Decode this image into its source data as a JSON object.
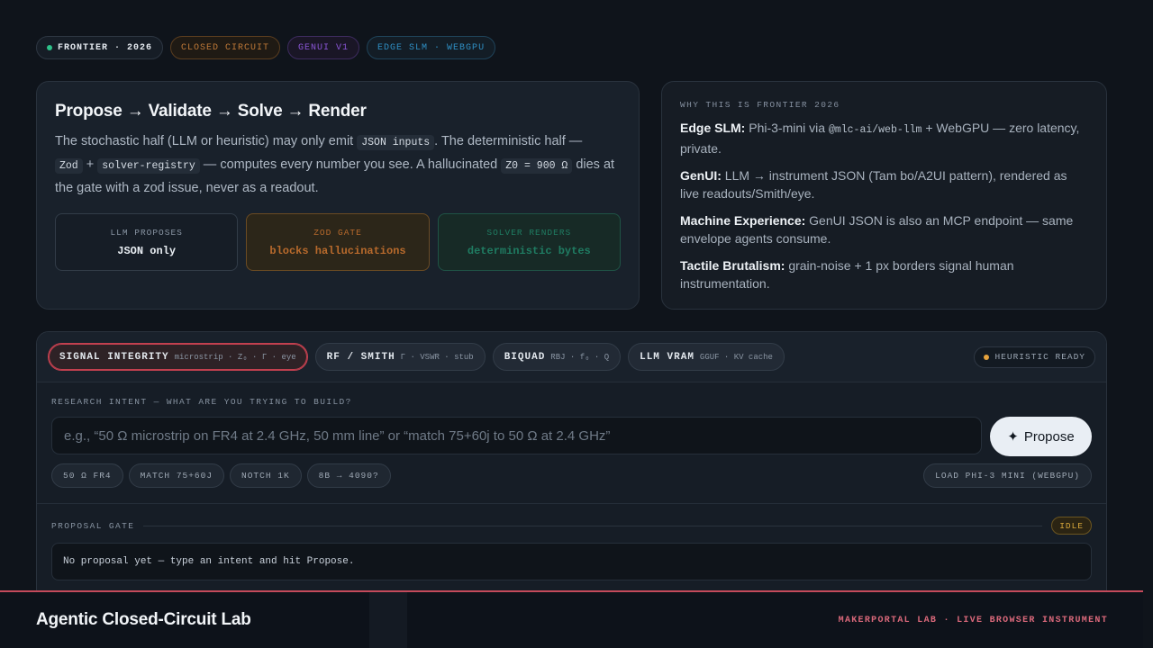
{
  "chips": {
    "frontier": "FRONTIER · 2026",
    "closed": "CLOSED CIRCUIT",
    "genui": "GENUI V1",
    "edge": "EDGE SLM · WEBGPU"
  },
  "pipeline": {
    "title": "Propose → Validate → Solve → Render",
    "desc_1": "The stochastic half (LLM or heuristic) may only emit ",
    "code_1": "JSON inputs",
    "desc_2": ". The deterministic half —",
    "code_2": "Zod",
    "desc_3": " + ",
    "code_3": "solver-registry",
    "desc_4": " — computes every number you see. A hallucinated ",
    "code_4": "Z0 = 900 Ω",
    "desc_5": " dies at the gate with a zod issue, never as a readout.",
    "stages": [
      {
        "label": "LLM PROPOSES",
        "value": "JSON only"
      },
      {
        "label": "ZOD GATE",
        "value": "blocks hallucinations"
      },
      {
        "label": "SOLVER RENDERS",
        "value": "deterministic bytes"
      }
    ]
  },
  "why": {
    "label": "WHY THIS IS FRONTIER 2026",
    "items": [
      {
        "title": "Edge SLM:",
        "text_a": " Phi-3-mini via ",
        "code": "@mlc-ai/web-llm",
        "text_b": " + WebGPU — zero latency, private."
      },
      {
        "title": "GenUI:",
        "text": " LLM → instrument JSON (Tam bo/A2UI pattern), rendered as live readouts/Smith/eye."
      },
      {
        "title": "Machine Experience:",
        "text": " GenUI JSON is also an MCP endpoint — same envelope agents consume."
      },
      {
        "title": "Tactile Brutalism:",
        "text": " grain-noise + 1 px borders signal human instrumentation."
      }
    ]
  },
  "tabs": [
    {
      "name": "SIGNAL INTEGRITY",
      "sub": "microstrip · Z₀ · Γ · eye",
      "active": true
    },
    {
      "name": "RF / SMITH",
      "sub": "Γ · VSWR · stub",
      "active": false
    },
    {
      "name": "BIQUAD",
      "sub": "RBJ · f₀ · Q",
      "active": false
    },
    {
      "name": "LLM VRAM",
      "sub": "GGUF · KV cache",
      "active": false
    }
  ],
  "status": {
    "heuristic": "HEURISTIC READY",
    "dot_color": "#e6a23c"
  },
  "intent": {
    "label": "RESEARCH INTENT — WHAT ARE YOU TRYING TO BUILD?",
    "placeholder": "e.g., “50 Ω microstrip on FR4 at 2.4 GHz, 50 mm line” or “match 75+60j to 50 Ω at 2.4 GHz”",
    "propose_label": "Propose",
    "presets": [
      "50 Ω FR4",
      "MATCH 75+60J",
      "NOTCH 1K",
      "8B → 4090?"
    ],
    "load_label": "LOAD PHI-3 MINI (WEBGPU)"
  },
  "gate": {
    "label": "PROPOSAL GATE",
    "badge": "IDLE",
    "message": "No proposal yet — type an intent and hit Propose."
  },
  "footer": {
    "title": "Agentic Closed-Circuit Lab",
    "right": "MAKERPORTAL LAB · LIVE BROWSER INSTRUMENT",
    "accent": "#c44a5b"
  }
}
